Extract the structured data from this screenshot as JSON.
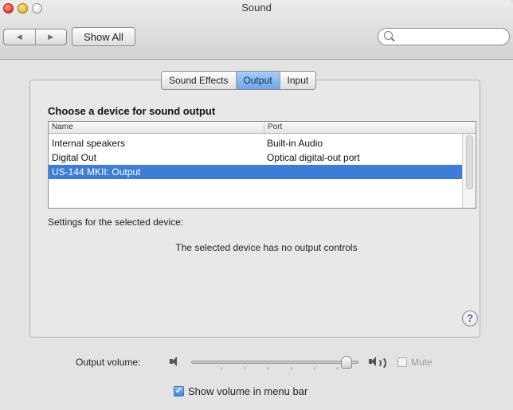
{
  "window": {
    "title": "Sound"
  },
  "toolbar": {
    "back_glyph": "◀",
    "forward_glyph": "▶",
    "show_all_label": "Show All",
    "search": {
      "value": "",
      "placeholder": ""
    }
  },
  "tabs": [
    {
      "label": "Sound Effects",
      "active": false
    },
    {
      "label": "Output",
      "active": true
    },
    {
      "label": "Input",
      "active": false
    }
  ],
  "output": {
    "heading": "Choose a device for sound output",
    "columns": [
      "Name",
      "Port"
    ],
    "devices": [
      {
        "name": "Internal speakers",
        "port": "Built-in Audio",
        "selected": false
      },
      {
        "name": "Digital Out",
        "port": "Optical digital-out port",
        "selected": false
      },
      {
        "name": "US-144 MKII: Output",
        "port": "",
        "selected": true
      }
    ],
    "settings_label": "Settings for the selected device:",
    "no_controls_text": "The selected device has no output controls"
  },
  "help_label": "?",
  "volume": {
    "label": "Output volume:",
    "level": 0.93,
    "mute_label": "Mute",
    "mute_checked": false,
    "show_in_menu_bar_label": "Show volume in menu bar",
    "show_in_menu_bar_checked": true
  },
  "colors": {
    "selection": "#3d7dd6",
    "active_tab": "#8ab9ef"
  }
}
